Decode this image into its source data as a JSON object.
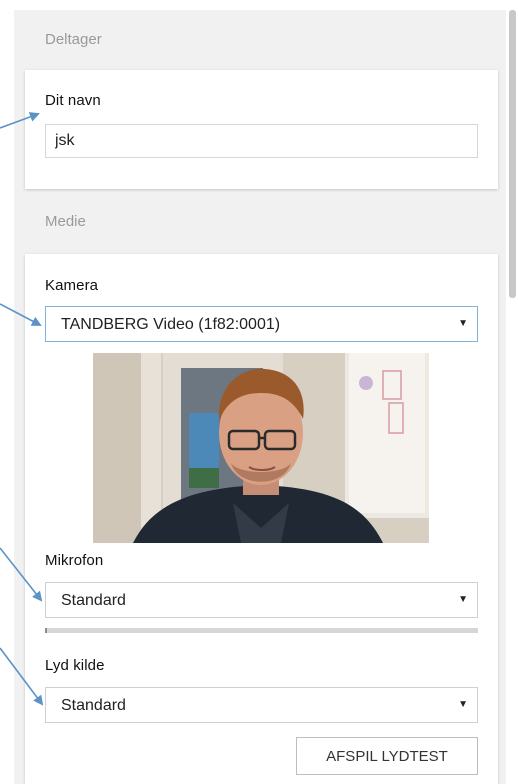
{
  "sections": {
    "participant_label": "Deltager",
    "media_label": "Medie"
  },
  "name_field": {
    "label": "Dit navn",
    "value": "jsk"
  },
  "camera": {
    "label": "Kamera",
    "selected": "TANDBERG Video (1f82:0001)"
  },
  "microphone": {
    "label": "Mikrofon",
    "selected": "Standard",
    "level_fraction": 0.005
  },
  "audio_source": {
    "label": "Lyd kilde",
    "selected": "Standard"
  },
  "sound_test_button": {
    "label": "AFSPIL LYDTEST"
  },
  "icons": {
    "dropdown": "caret-down-icon"
  },
  "colors": {
    "panel_bg": "#f1f1f1",
    "focus_border": "#7fb2e0",
    "annotation_arrow": "#5b93c9"
  }
}
